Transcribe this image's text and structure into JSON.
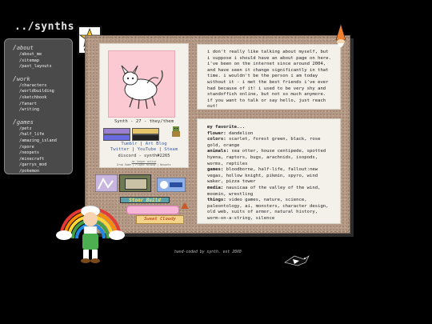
{
  "header": {
    "site_title": "../synths",
    "badge_text": "NORMAL"
  },
  "sidebar": {
    "sections": [
      {
        "title": "about",
        "items": [
          "/about_me",
          "/sitemap",
          "/past_layouts"
        ]
      },
      {
        "title": "work",
        "items": [
          "/characters",
          "/worldbuilding",
          "/sketchbook",
          "/fanart",
          "/writing"
        ]
      },
      {
        "title": "games",
        "items": [
          "/petz",
          "/half_life",
          "/amazing_island",
          "/spore",
          "/neopets",
          "/minecraft",
          "/garrys_mod",
          "/pokemon"
        ]
      }
    ]
  },
  "profile": {
    "name_line": "Synth - 27 - they/them",
    "links": {
      "tumblr": "Tumblr",
      "art_blog": "Art Blog",
      "twitter": "Twitter",
      "youtube": "YouTube",
      "steam": "Steam"
    },
    "discord": "discord - synth#2265",
    "small_status": "no longer active",
    "small_links": "Drop Game | Flight Rising | Neopets",
    "avatar_bg": "#fbc9d2"
  },
  "stamps": {
    "pride_label": "Stonr Build",
    "sticker_label": "Sweet Cloudy"
  },
  "about": {
    "text": "i don't really like talking about myself, but i suppose i should have an about page on here. i've been on the internet since around 2004, and have seen it change significantly in that time. i wouldn't be the person i am today without it - i met the best friends i've ever had because of it! i used to be very shy and standoffish online, but not so much anymore. if you want to talk or say hello, just reach out!"
  },
  "favorites": {
    "title": "my favorite...",
    "items": [
      {
        "key": "flower:",
        "value": "dandelion"
      },
      {
        "key": "colors:",
        "value": "scarlet, forest green, black, rose gold, orange"
      },
      {
        "key": "animals:",
        "value": "sea otter, house centipede, spotted hyena, raptors, bugs, arachnids, isopods, worms, reptiles"
      },
      {
        "key": "games:",
        "value": "bloodborne, half-life, fallout:new vegas, hollow knight, pikmin, spyro, wind waker, pizza tower"
      },
      {
        "key": "media:",
        "value": "nausicaa of the valley of the wind, moomin, wrestling"
      },
      {
        "key": "things:",
        "value": "video games, nature, science, paleontology, ai, monsters, character design, old web, suits of armor, natural history, worm-on-a-string, silence"
      }
    ]
  },
  "footer": {
    "text": "hand-coded by synth. est 20X0"
  },
  "colors": {
    "page_bg": "#000000",
    "sidebar_bg": "#4a4a4a",
    "board_bg": "#b49a86",
    "card_bg": "#f4f1ea",
    "link": "#3a5ea8"
  }
}
